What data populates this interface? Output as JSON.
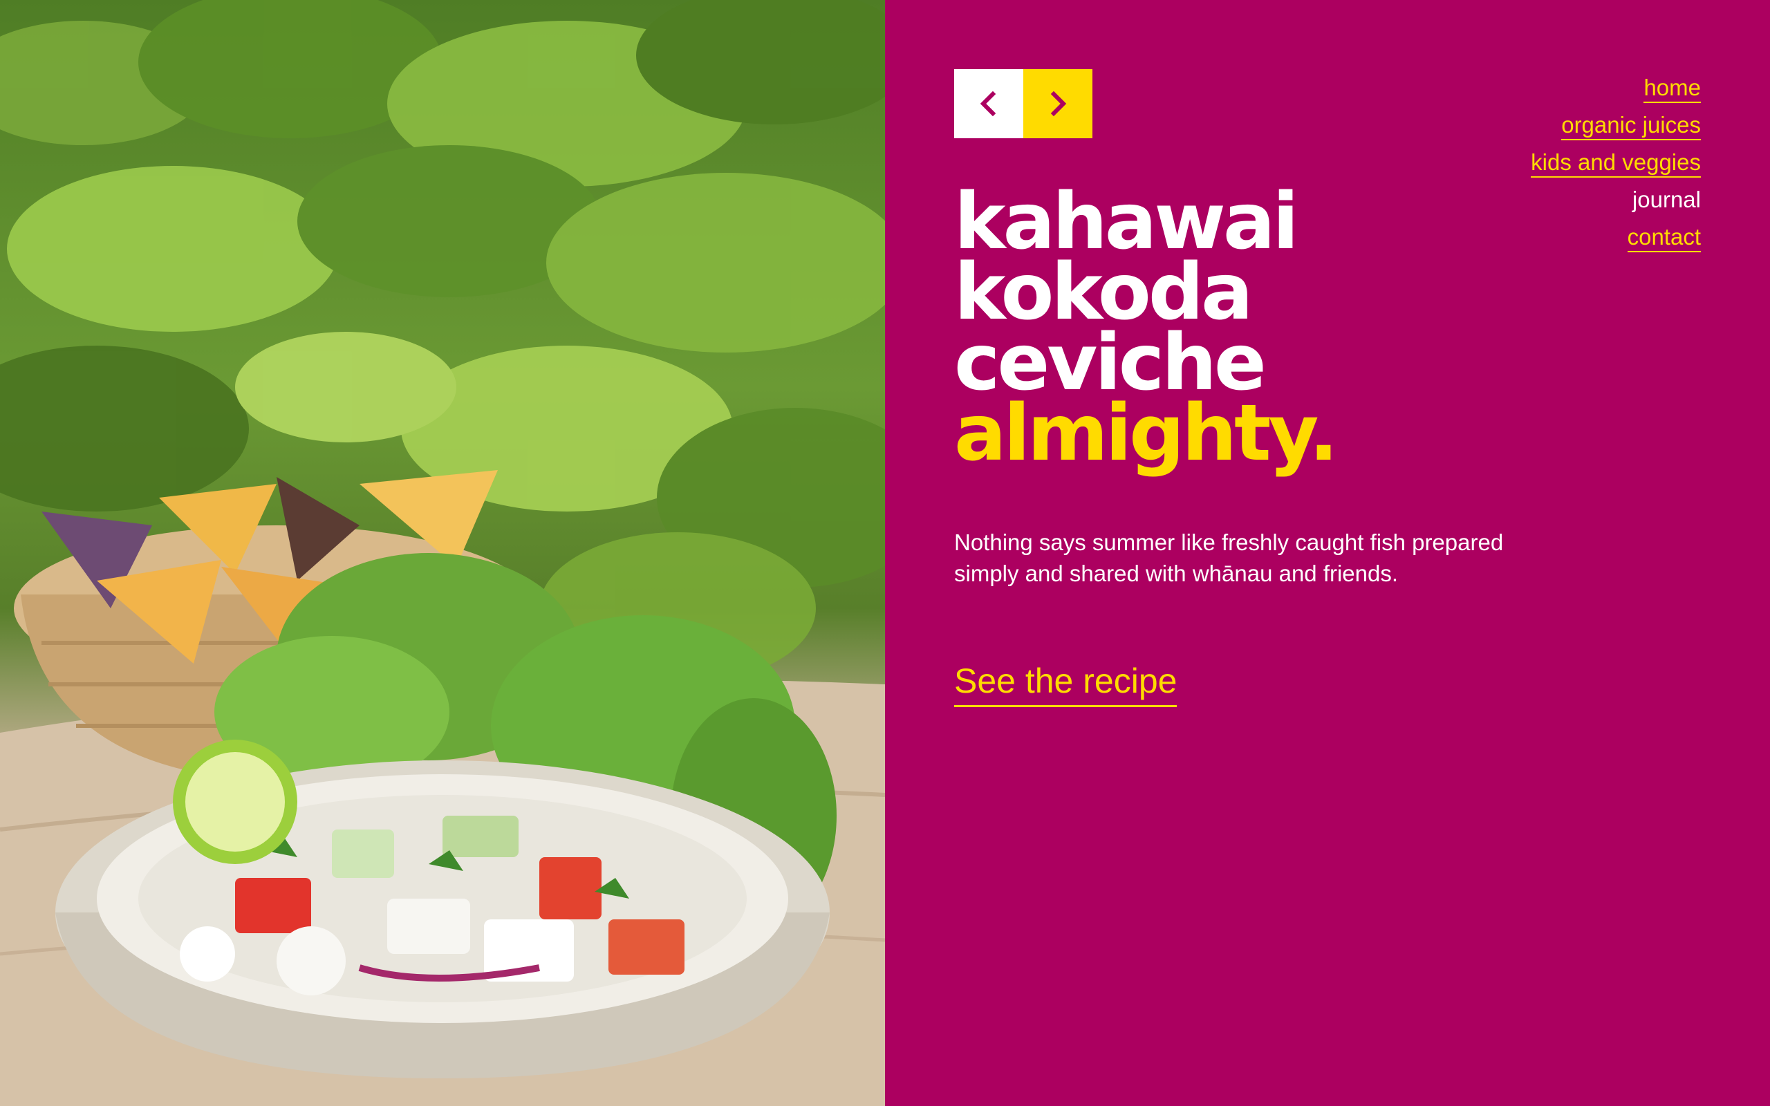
{
  "colors": {
    "panel": "#ac0060",
    "accent": "#ffdb00",
    "text": "#ffffff"
  },
  "hero": {
    "image_alt": "Bowl of kahawai kokoda ceviche with lettuce, lime and tortilla chips"
  },
  "slider": {
    "prev_icon": "chevron-left-icon",
    "next_icon": "chevron-right-icon"
  },
  "nav": {
    "items": [
      {
        "label": "home",
        "current": false
      },
      {
        "label": "organic juices",
        "current": false
      },
      {
        "label": "kids and veggies",
        "current": false
      },
      {
        "label": "journal",
        "current": true
      },
      {
        "label": "contact",
        "current": false
      }
    ]
  },
  "article": {
    "title_lines": [
      "kahawai",
      "kokoda",
      "ceviche"
    ],
    "title_accent": "almighty.",
    "intro": "Nothing says summer like freshly caught fish prepared simply and shared with whānau and friends.",
    "cta": "See the recipe"
  }
}
